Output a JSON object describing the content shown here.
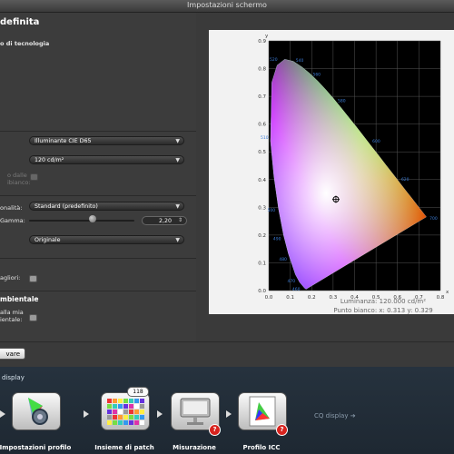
{
  "window": {
    "title": "Impostazioni schermo"
  },
  "settings": {
    "heading": "definita",
    "tech_label": "o di tecnologia",
    "illuminant": "Illuminante CIE D65",
    "luminance_select": "120 cd/m²",
    "from_label_1": "o dalle",
    "from_label_2": "ibianco:",
    "tonality_label": "onalità:",
    "tonality_value": "Standard (predefinito)",
    "gamma_label": "Gamma:",
    "gamma_value": "2,20",
    "gamma_level": 0.6,
    "original_value": "Originale",
    "improvements_label": "agliori:",
    "ambient_heading": "mbientale",
    "ambient_label_1": "alla mia",
    "ambient_label_2": "ientale:",
    "save_label": "vare"
  },
  "chart": {
    "luminance_text": "Luminanza: 120.000 cd/m²",
    "white_point_text": "Punto bianco: x: 0.313  y: 0.329"
  },
  "chart_data": {
    "type": "scatter",
    "title": "",
    "xlabel": "x",
    "ylabel": "y",
    "xlim": [
      0,
      0.8
    ],
    "ylim": [
      0,
      0.9
    ],
    "x_ticks": [
      "0.0",
      "0.1",
      "0.2",
      "0.3",
      "0.4",
      "0.5",
      "0.6",
      "0.7",
      "0.8"
    ],
    "y_ticks": [
      "0.0",
      "0.1",
      "0.2",
      "0.3",
      "0.4",
      "0.5",
      "0.6",
      "0.7",
      "0.8",
      "0.9"
    ],
    "grid": true,
    "locus": [
      [
        0.1741,
        0.005
      ],
      [
        0.1666,
        0.0089
      ],
      [
        0.144,
        0.0297
      ],
      [
        0.1241,
        0.0578
      ],
      [
        0.0913,
        0.1327
      ],
      [
        0.0687,
        0.2007
      ],
      [
        0.0454,
        0.295
      ],
      [
        0.0235,
        0.4127
      ],
      [
        0.0082,
        0.5384
      ],
      [
        0.0139,
        0.7502
      ],
      [
        0.0389,
        0.812
      ],
      [
        0.0743,
        0.8338
      ],
      [
        0.1142,
        0.8262
      ],
      [
        0.1547,
        0.8059
      ],
      [
        0.1929,
        0.7816
      ],
      [
        0.2296,
        0.7543
      ],
      [
        0.2658,
        0.7243
      ],
      [
        0.3016,
        0.6923
      ],
      [
        0.3373,
        0.6589
      ],
      [
        0.3731,
        0.6245
      ],
      [
        0.4087,
        0.5896
      ],
      [
        0.4441,
        0.5547
      ],
      [
        0.4788,
        0.5202
      ],
      [
        0.5125,
        0.4866
      ],
      [
        0.5448,
        0.4544
      ],
      [
        0.5752,
        0.4242
      ],
      [
        0.6029,
        0.3965
      ],
      [
        0.627,
        0.3725
      ],
      [
        0.6482,
        0.3514
      ],
      [
        0.6658,
        0.334
      ],
      [
        0.6915,
        0.3083
      ],
      [
        0.7347,
        0.2653
      ]
    ],
    "wavelength_labels": [
      "460",
      "470",
      "480",
      "490",
      "500",
      "510",
      "520",
      "540",
      "560",
      "580",
      "600",
      "620",
      "700"
    ],
    "white_point": {
      "x": 0.313,
      "y": 0.329
    }
  },
  "workflow": {
    "title": "display",
    "steps": [
      {
        "label": "Impostazioni profilo",
        "icon": "gear-icon"
      },
      {
        "label": "Insieme di patch",
        "icon": "patch-grid-icon",
        "badge": "118"
      },
      {
        "label": "Misurazione",
        "icon": "monitor-icon"
      },
      {
        "label": "Profilo ICC",
        "icon": "icc-profile-icon"
      }
    ],
    "next_label": "CQ display"
  }
}
